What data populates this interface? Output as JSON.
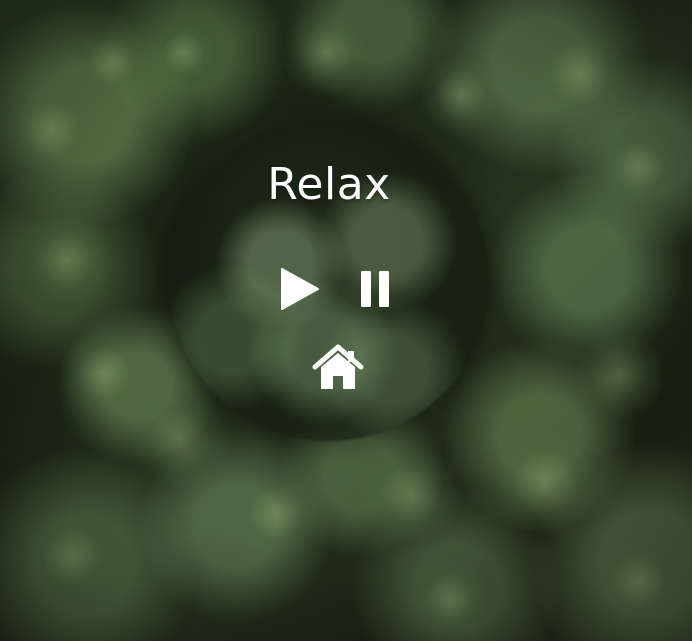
{
  "app": {
    "title": "Relax"
  },
  "controls": {
    "play_icon": "play-icon",
    "pause_icon": "pause-icon",
    "home_icon": "home-icon"
  },
  "colors": {
    "text": "#ffffff",
    "icon": "#ffffff"
  }
}
